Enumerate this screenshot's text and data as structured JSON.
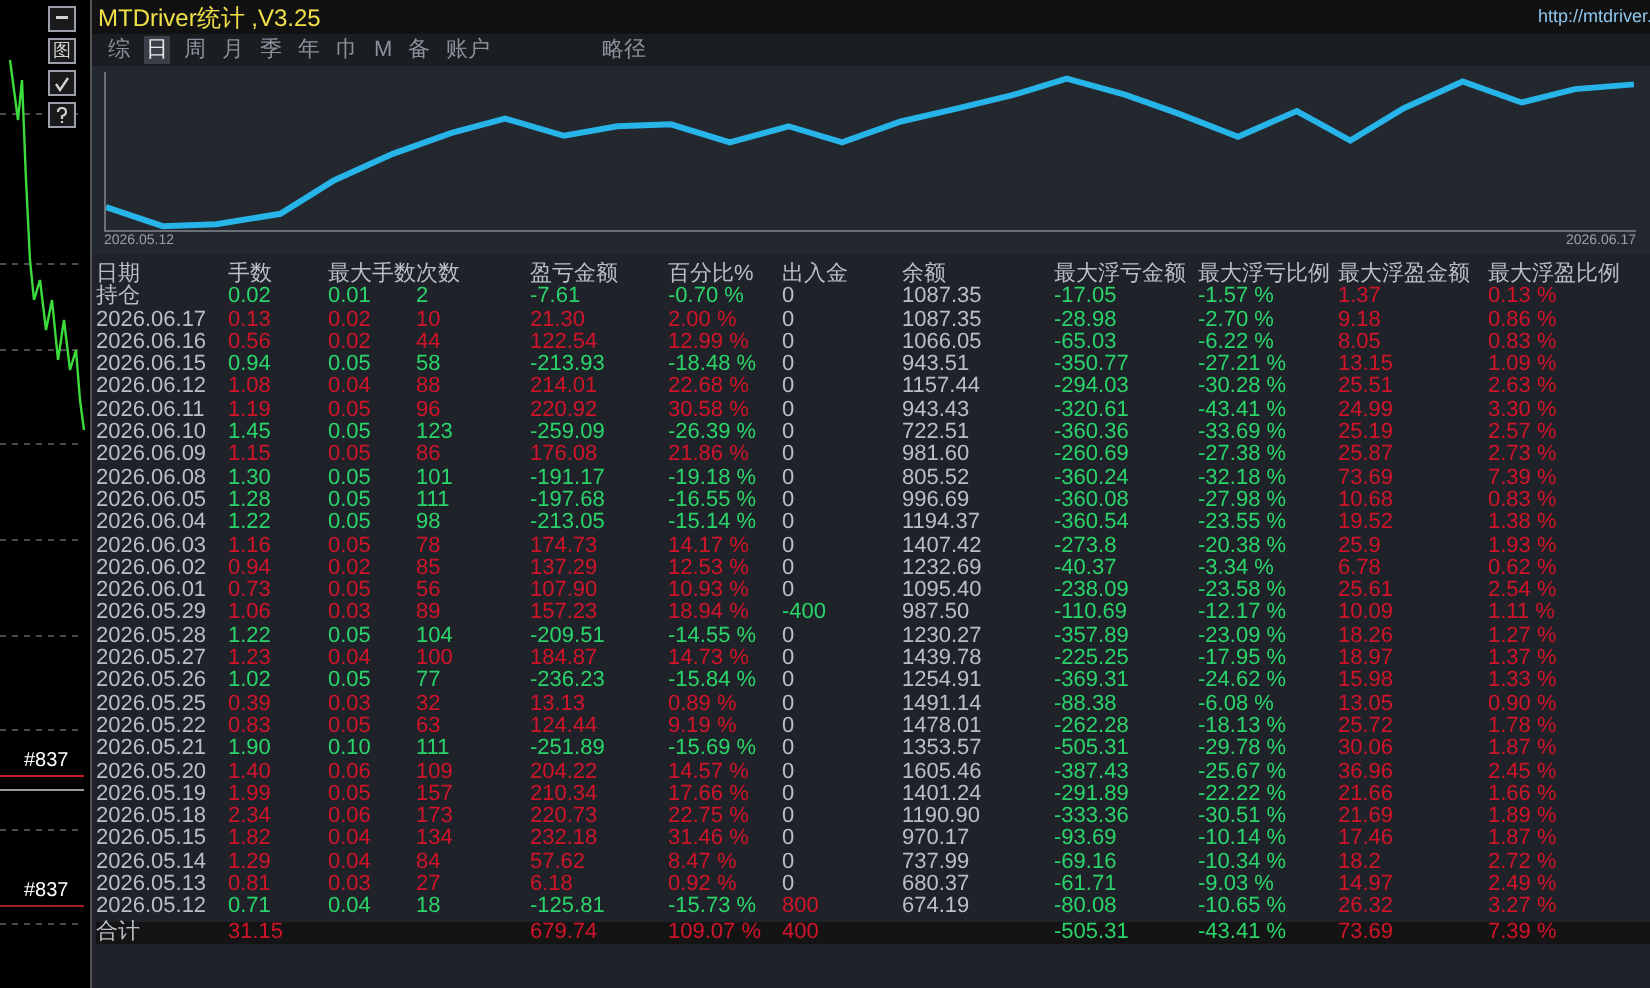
{
  "window": {
    "title": "MTDriver统计 ,V3.25",
    "url": "http://mtdriver."
  },
  "side_buttons": [
    {
      "kind": "minimize"
    },
    {
      "kind": "graph",
      "label": "图"
    },
    {
      "kind": "check"
    },
    {
      "kind": "help"
    }
  ],
  "side_labels": [
    "#837",
    "#837"
  ],
  "tabs": [
    {
      "label": "综",
      "selected": false
    },
    {
      "label": "日",
      "selected": true
    },
    {
      "label": "周",
      "selected": false
    },
    {
      "label": "月",
      "selected": false
    },
    {
      "label": "季",
      "selected": false
    },
    {
      "label": "年",
      "selected": false
    },
    {
      "label": "巾",
      "selected": false
    },
    {
      "label": "M",
      "selected": false
    },
    {
      "label": "备",
      "selected": false
    },
    {
      "label": "账户",
      "selected": false
    }
  ],
  "extra_tab": {
    "label": "略径",
    "selected": false
  },
  "chart": {
    "start_date": "2026.05.12",
    "end_date": "2026.06.17"
  },
  "table": {
    "columns": [
      "日期",
      "手数",
      "最大手数",
      "次数",
      "盈亏金额",
      "百分比%",
      "出入金",
      "余额",
      "最大浮亏金额",
      "最大浮亏比例",
      "最大浮盈金额",
      "最大浮盈比例"
    ],
    "rows": [
      {
        "date": "持仓",
        "lots": "0.02",
        "max_lots": "0.01",
        "count": "2",
        "pnl": "-7.61",
        "pct": "-0.70 %",
        "deposit": {
          "value": "0",
          "kind": "none"
        },
        "balance": "1087.35",
        "max_dd": "-17.05",
        "max_dd_pct": "-1.57 %",
        "max_fp": "1.37",
        "max_fp_pct": "0.13 %",
        "kind": "loss"
      },
      {
        "date": "2026.06.17",
        "lots": "0.13",
        "max_lots": "0.02",
        "count": "10",
        "pnl": "21.30",
        "pct": "2.00 %",
        "deposit": {
          "value": "0",
          "kind": "none"
        },
        "balance": "1087.35",
        "max_dd": "-28.98",
        "max_dd_pct": "-2.70 %",
        "max_fp": "9.18",
        "max_fp_pct": "0.86 %",
        "kind": "gain"
      },
      {
        "date": "2026.06.16",
        "lots": "0.56",
        "max_lots": "0.02",
        "count": "44",
        "pnl": "122.54",
        "pct": "12.99 %",
        "deposit": {
          "value": "0",
          "kind": "none"
        },
        "balance": "1066.05",
        "max_dd": "-65.03",
        "max_dd_pct": "-6.22 %",
        "max_fp": "8.05",
        "max_fp_pct": "0.83 %",
        "kind": "gain"
      },
      {
        "date": "2026.06.15",
        "lots": "0.94",
        "max_lots": "0.05",
        "count": "58",
        "pnl": "-213.93",
        "pct": "-18.48 %",
        "deposit": {
          "value": "0",
          "kind": "none"
        },
        "balance": "943.51",
        "max_dd": "-350.77",
        "max_dd_pct": "-27.21 %",
        "max_fp": "13.15",
        "max_fp_pct": "1.09 %",
        "kind": "loss"
      },
      {
        "date": "2026.06.12",
        "lots": "1.08",
        "max_lots": "0.04",
        "count": "88",
        "pnl": "214.01",
        "pct": "22.68 %",
        "deposit": {
          "value": "0",
          "kind": "none"
        },
        "balance": "1157.44",
        "max_dd": "-294.03",
        "max_dd_pct": "-30.28 %",
        "max_fp": "25.51",
        "max_fp_pct": "2.63 %",
        "kind": "gain"
      },
      {
        "date": "2026.06.11",
        "lots": "1.19",
        "max_lots": "0.05",
        "count": "96",
        "pnl": "220.92",
        "pct": "30.58 %",
        "deposit": {
          "value": "0",
          "kind": "none"
        },
        "balance": "943.43",
        "max_dd": "-320.61",
        "max_dd_pct": "-43.41 %",
        "max_fp": "24.99",
        "max_fp_pct": "3.30 %",
        "kind": "gain"
      },
      {
        "date": "2026.06.10",
        "lots": "1.45",
        "max_lots": "0.05",
        "count": "123",
        "pnl": "-259.09",
        "pct": "-26.39 %",
        "deposit": {
          "value": "0",
          "kind": "none"
        },
        "balance": "722.51",
        "max_dd": "-360.36",
        "max_dd_pct": "-33.69 %",
        "max_fp": "25.19",
        "max_fp_pct": "2.57 %",
        "kind": "loss"
      },
      {
        "date": "2026.06.09",
        "lots": "1.15",
        "max_lots": "0.05",
        "count": "86",
        "pnl": "176.08",
        "pct": "21.86 %",
        "deposit": {
          "value": "0",
          "kind": "none"
        },
        "balance": "981.60",
        "max_dd": "-260.69",
        "max_dd_pct": "-27.38 %",
        "max_fp": "25.87",
        "max_fp_pct": "2.73 %",
        "kind": "gain"
      },
      {
        "date": "2026.06.08",
        "lots": "1.30",
        "max_lots": "0.05",
        "count": "101",
        "pnl": "-191.17",
        "pct": "-19.18 %",
        "deposit": {
          "value": "0",
          "kind": "none"
        },
        "balance": "805.52",
        "max_dd": "-360.24",
        "max_dd_pct": "-32.18 %",
        "max_fp": "73.69",
        "max_fp_pct": "7.39 %",
        "kind": "loss"
      },
      {
        "date": "2026.06.05",
        "lots": "1.28",
        "max_lots": "0.05",
        "count": "111",
        "pnl": "-197.68",
        "pct": "-16.55 %",
        "deposit": {
          "value": "0",
          "kind": "none"
        },
        "balance": "996.69",
        "max_dd": "-360.08",
        "max_dd_pct": "-27.98 %",
        "max_fp": "10.68",
        "max_fp_pct": "0.83 %",
        "kind": "loss"
      },
      {
        "date": "2026.06.04",
        "lots": "1.22",
        "max_lots": "0.05",
        "count": "98",
        "pnl": "-213.05",
        "pct": "-15.14 %",
        "deposit": {
          "value": "0",
          "kind": "none"
        },
        "balance": "1194.37",
        "max_dd": "-360.54",
        "max_dd_pct": "-23.55 %",
        "max_fp": "19.52",
        "max_fp_pct": "1.38 %",
        "kind": "loss"
      },
      {
        "date": "2026.06.03",
        "lots": "1.16",
        "max_lots": "0.05",
        "count": "78",
        "pnl": "174.73",
        "pct": "14.17 %",
        "deposit": {
          "value": "0",
          "kind": "none"
        },
        "balance": "1407.42",
        "max_dd": "-273.8",
        "max_dd_pct": "-20.38 %",
        "max_fp": "25.9",
        "max_fp_pct": "1.93 %",
        "kind": "gain"
      },
      {
        "date": "2026.06.02",
        "lots": "0.94",
        "max_lots": "0.02",
        "count": "85",
        "pnl": "137.29",
        "pct": "12.53 %",
        "deposit": {
          "value": "0",
          "kind": "none"
        },
        "balance": "1232.69",
        "max_dd": "-40.37",
        "max_dd_pct": "-3.34 %",
        "max_fp": "6.78",
        "max_fp_pct": "0.62 %",
        "kind": "gain"
      },
      {
        "date": "2026.06.01",
        "lots": "0.73",
        "max_lots": "0.05",
        "count": "56",
        "pnl": "107.90",
        "pct": "10.93 %",
        "deposit": {
          "value": "0",
          "kind": "none"
        },
        "balance": "1095.40",
        "max_dd": "-238.09",
        "max_dd_pct": "-23.58 %",
        "max_fp": "25.61",
        "max_fp_pct": "2.54 %",
        "kind": "gain"
      },
      {
        "date": "2026.05.29",
        "lots": "1.06",
        "max_lots": "0.03",
        "count": "89",
        "pnl": "157.23",
        "pct": "18.94 %",
        "deposit": {
          "value": "-400",
          "kind": "withdrawal"
        },
        "balance": "987.50",
        "max_dd": "-110.69",
        "max_dd_pct": "-12.17 %",
        "max_fp": "10.09",
        "max_fp_pct": "1.11 %",
        "kind": "gain"
      },
      {
        "date": "2026.05.28",
        "lots": "1.22",
        "max_lots": "0.05",
        "count": "104",
        "pnl": "-209.51",
        "pct": "-14.55 %",
        "deposit": {
          "value": "0",
          "kind": "none"
        },
        "balance": "1230.27",
        "max_dd": "-357.89",
        "max_dd_pct": "-23.09 %",
        "max_fp": "18.26",
        "max_fp_pct": "1.27 %",
        "kind": "loss"
      },
      {
        "date": "2026.05.27",
        "lots": "1.23",
        "max_lots": "0.04",
        "count": "100",
        "pnl": "184.87",
        "pct": "14.73 %",
        "deposit": {
          "value": "0",
          "kind": "none"
        },
        "balance": "1439.78",
        "max_dd": "-225.25",
        "max_dd_pct": "-17.95 %",
        "max_fp": "18.97",
        "max_fp_pct": "1.37 %",
        "kind": "gain"
      },
      {
        "date": "2026.05.26",
        "lots": "1.02",
        "max_lots": "0.05",
        "count": "77",
        "pnl": "-236.23",
        "pct": "-15.84 %",
        "deposit": {
          "value": "0",
          "kind": "none"
        },
        "balance": "1254.91",
        "max_dd": "-369.31",
        "max_dd_pct": "-24.62 %",
        "max_fp": "15.98",
        "max_fp_pct": "1.33 %",
        "kind": "loss"
      },
      {
        "date": "2026.05.25",
        "lots": "0.39",
        "max_lots": "0.03",
        "count": "32",
        "pnl": "13.13",
        "pct": "0.89 %",
        "deposit": {
          "value": "0",
          "kind": "none"
        },
        "balance": "1491.14",
        "max_dd": "-88.38",
        "max_dd_pct": "-6.08 %",
        "max_fp": "13.05",
        "max_fp_pct": "0.90 %",
        "kind": "gain"
      },
      {
        "date": "2026.05.22",
        "lots": "0.83",
        "max_lots": "0.05",
        "count": "63",
        "pnl": "124.44",
        "pct": "9.19 %",
        "deposit": {
          "value": "0",
          "kind": "none"
        },
        "balance": "1478.01",
        "max_dd": "-262.28",
        "max_dd_pct": "-18.13 %",
        "max_fp": "25.72",
        "max_fp_pct": "1.78 %",
        "kind": "gain"
      },
      {
        "date": "2026.05.21",
        "lots": "1.90",
        "max_lots": "0.10",
        "count": "111",
        "pnl": "-251.89",
        "pct": "-15.69 %",
        "deposit": {
          "value": "0",
          "kind": "none"
        },
        "balance": "1353.57",
        "max_dd": "-505.31",
        "max_dd_pct": "-29.78 %",
        "max_fp": "30.06",
        "max_fp_pct": "1.87 %",
        "kind": "loss"
      },
      {
        "date": "2026.05.20",
        "lots": "1.40",
        "max_lots": "0.06",
        "count": "109",
        "pnl": "204.22",
        "pct": "14.57 %",
        "deposit": {
          "value": "0",
          "kind": "none"
        },
        "balance": "1605.46",
        "max_dd": "-387.43",
        "max_dd_pct": "-25.67 %",
        "max_fp": "36.96",
        "max_fp_pct": "2.45 %",
        "kind": "gain"
      },
      {
        "date": "2026.05.19",
        "lots": "1.99",
        "max_lots": "0.05",
        "count": "157",
        "pnl": "210.34",
        "pct": "17.66 %",
        "deposit": {
          "value": "0",
          "kind": "none"
        },
        "balance": "1401.24",
        "max_dd": "-291.89",
        "max_dd_pct": "-22.22 %",
        "max_fp": "21.66",
        "max_fp_pct": "1.66 %",
        "kind": "gain"
      },
      {
        "date": "2026.05.18",
        "lots": "2.34",
        "max_lots": "0.06",
        "count": "173",
        "pnl": "220.73",
        "pct": "22.75 %",
        "deposit": {
          "value": "0",
          "kind": "none"
        },
        "balance": "1190.90",
        "max_dd": "-333.36",
        "max_dd_pct": "-30.51 %",
        "max_fp": "21.69",
        "max_fp_pct": "1.89 %",
        "kind": "gain"
      },
      {
        "date": "2026.05.15",
        "lots": "1.82",
        "max_lots": "0.04",
        "count": "134",
        "pnl": "232.18",
        "pct": "31.46 %",
        "deposit": {
          "value": "0",
          "kind": "none"
        },
        "balance": "970.17",
        "max_dd": "-93.69",
        "max_dd_pct": "-10.14 %",
        "max_fp": "17.46",
        "max_fp_pct": "1.87 %",
        "kind": "gain"
      },
      {
        "date": "2026.05.14",
        "lots": "1.29",
        "max_lots": "0.04",
        "count": "84",
        "pnl": "57.62",
        "pct": "8.47 %",
        "deposit": {
          "value": "0",
          "kind": "none"
        },
        "balance": "737.99",
        "max_dd": "-69.16",
        "max_dd_pct": "-10.34 %",
        "max_fp": "18.2",
        "max_fp_pct": "2.72 %",
        "kind": "gain"
      },
      {
        "date": "2026.05.13",
        "lots": "0.81",
        "max_lots": "0.03",
        "count": "27",
        "pnl": "6.18",
        "pct": "0.92 %",
        "deposit": {
          "value": "0",
          "kind": "none"
        },
        "balance": "680.37",
        "max_dd": "-61.71",
        "max_dd_pct": "-9.03 %",
        "max_fp": "14.97",
        "max_fp_pct": "2.49 %",
        "kind": "gain"
      },
      {
        "date": "2026.05.12",
        "lots": "0.71",
        "max_lots": "0.04",
        "count": "18",
        "pnl": "-125.81",
        "pct": "-15.73 %",
        "deposit": {
          "value": "800",
          "kind": "deposit"
        },
        "balance": "674.19",
        "max_dd": "-80.08",
        "max_dd_pct": "-10.65 %",
        "max_fp": "26.32",
        "max_fp_pct": "3.27 %",
        "kind": "loss"
      }
    ],
    "totals": {
      "label": "合计",
      "lots": "31.15",
      "pnl": "679.74",
      "pct": "109.07 %",
      "deposit": "400",
      "max_dd": "-505.31",
      "max_dd_pct": "-43.41 %",
      "max_fp": "73.69",
      "max_fp_pct": "7.39 %"
    }
  }
}
